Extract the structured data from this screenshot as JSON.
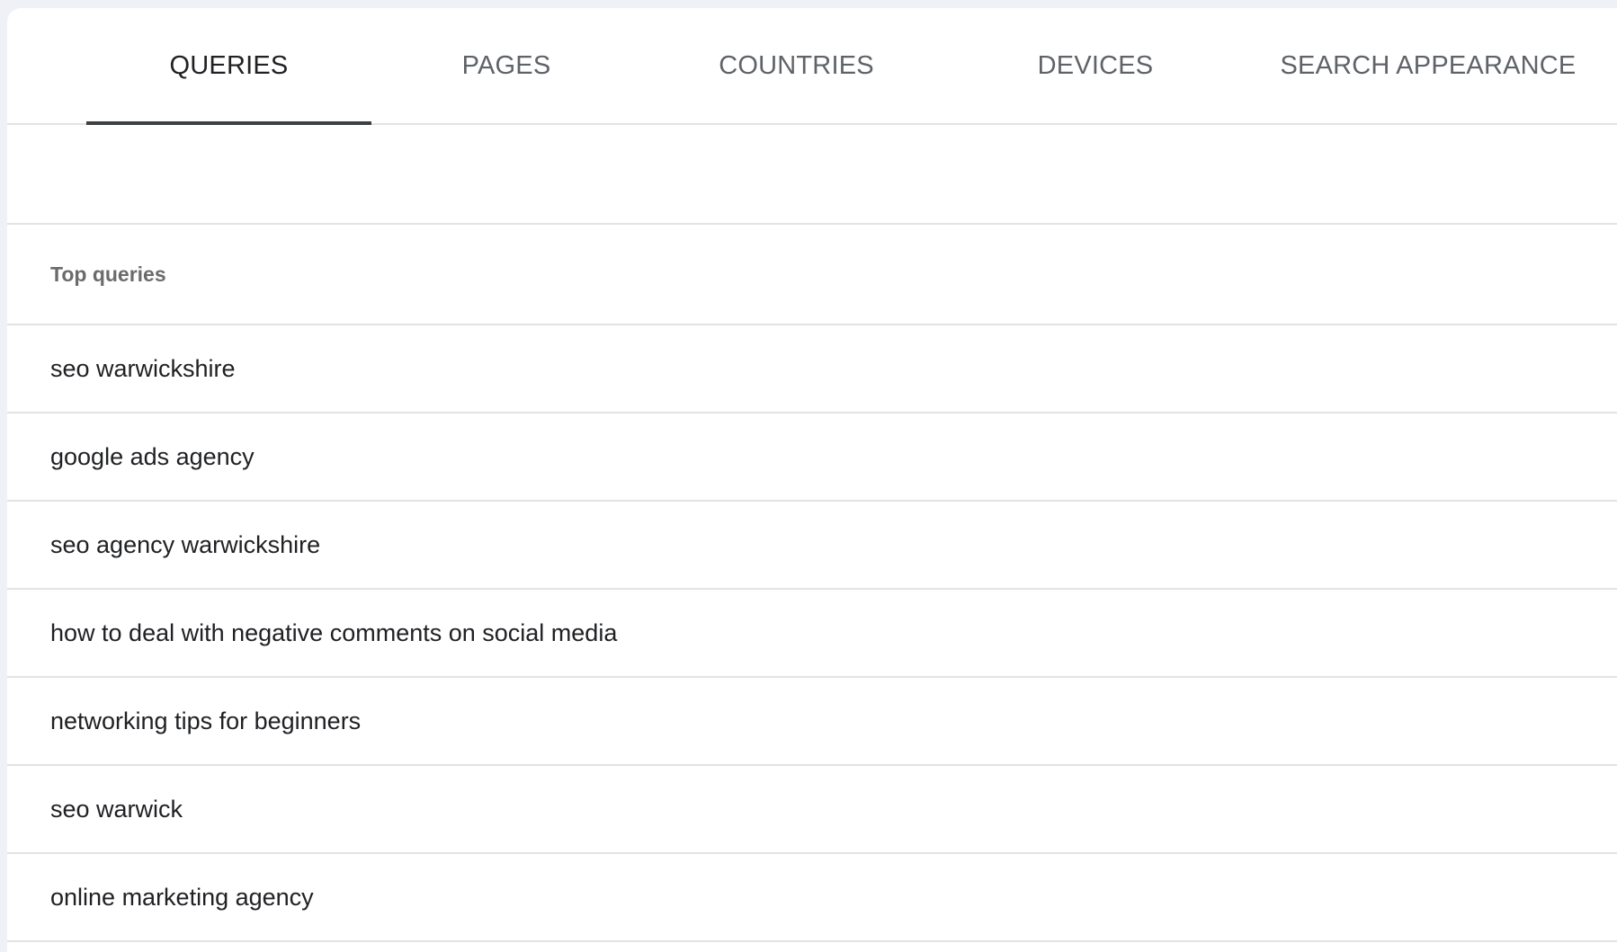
{
  "tabs": [
    {
      "label": "QUERIES",
      "active": true
    },
    {
      "label": "PAGES",
      "active": false
    },
    {
      "label": "COUNTRIES",
      "active": false
    },
    {
      "label": "DEVICES",
      "active": false
    },
    {
      "label": "SEARCH APPEARANCE",
      "active": false
    }
  ],
  "table": {
    "header": "Top queries",
    "rows": [
      "seo warwickshire",
      "google ads agency",
      "seo agency warwickshire",
      "how to deal with negative comments on social media",
      "networking tips for beginners",
      "seo warwick",
      "online marketing agency"
    ]
  },
  "colors": {
    "background": "#eef2f7",
    "active_tab_text": "#202124",
    "inactive_tab_text": "#5f6368",
    "indicator": "#3c4043",
    "divider": "#e3e3e3"
  }
}
